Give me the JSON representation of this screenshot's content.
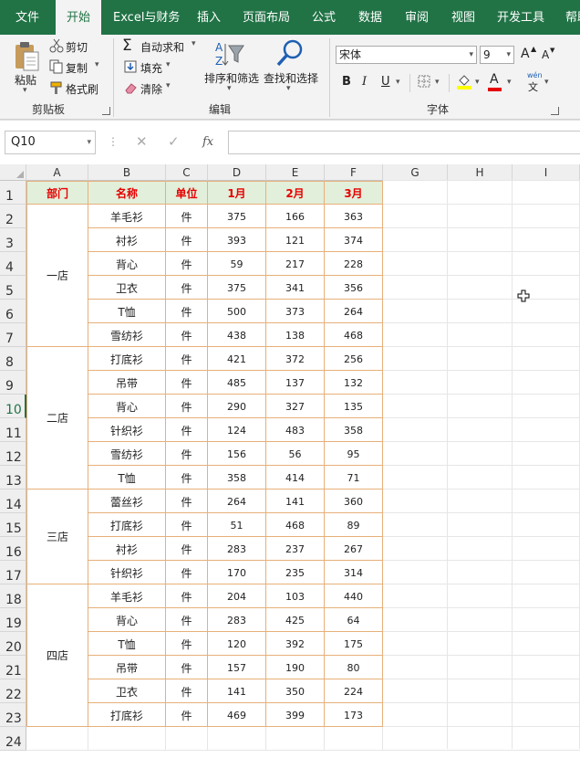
{
  "ribbon_tabs": [
    "文件",
    "开始",
    "Excel与财务",
    "插入",
    "页面布局",
    "公式",
    "数据",
    "审阅",
    "视图",
    "开发工具",
    "帮助"
  ],
  "clipboard": {
    "paste": "粘贴",
    "cut": "剪切",
    "copy": "复制",
    "format_painter": "格式刷",
    "group": "剪贴板"
  },
  "editing": {
    "autosum": "自动求和",
    "fill": "填充",
    "clear": "清除",
    "sort": "排序和筛选",
    "find": "查找和选择",
    "group": "编辑"
  },
  "font": {
    "name": "宋体",
    "size": "9",
    "group": "字体",
    "bold": "B",
    "italic": "I",
    "underline": "U",
    "grow": "A",
    "shrink": "A",
    "fontcolor": "A",
    "wen": "wén",
    "wen2": "文"
  },
  "name_box": "Q10",
  "fx_label": "fx",
  "cancel_glyph": "✕",
  "enter_glyph": "✓",
  "columns": [
    "A",
    "B",
    "C",
    "D",
    "E",
    "F",
    "G",
    "H",
    "I"
  ],
  "rows": [
    "1",
    "2",
    "3",
    "4",
    "5",
    "6",
    "7",
    "8",
    "9",
    "10",
    "11",
    "12",
    "13",
    "14",
    "15",
    "16",
    "17",
    "18",
    "19",
    "20",
    "21",
    "22",
    "23",
    "24"
  ],
  "selected_row": "10",
  "table": {
    "headers": [
      "部门",
      "名称",
      "单位",
      "1月",
      "2月",
      "3月"
    ],
    "groups": [
      {
        "dept": "一店",
        "items": [
          [
            "羊毛衫",
            "件",
            "375",
            "166",
            "363"
          ],
          [
            "衬衫",
            "件",
            "393",
            "121",
            "374"
          ],
          [
            "背心",
            "件",
            "59",
            "217",
            "228"
          ],
          [
            "卫衣",
            "件",
            "375",
            "341",
            "356"
          ],
          [
            "T恤",
            "件",
            "500",
            "373",
            "264"
          ],
          [
            "雪纺衫",
            "件",
            "438",
            "138",
            "468"
          ]
        ]
      },
      {
        "dept": "二店",
        "items": [
          [
            "打底衫",
            "件",
            "421",
            "372",
            "256"
          ],
          [
            "吊带",
            "件",
            "485",
            "137",
            "132"
          ],
          [
            "背心",
            "件",
            "290",
            "327",
            "135"
          ],
          [
            "针织衫",
            "件",
            "124",
            "483",
            "358"
          ],
          [
            "雪纺衫",
            "件",
            "156",
            "56",
            "95"
          ],
          [
            "T恤",
            "件",
            "358",
            "414",
            "71"
          ]
        ]
      },
      {
        "dept": "三店",
        "items": [
          [
            "蕾丝衫",
            "件",
            "264",
            "141",
            "360"
          ],
          [
            "打底衫",
            "件",
            "51",
            "468",
            "89"
          ],
          [
            "衬衫",
            "件",
            "283",
            "237",
            "267"
          ],
          [
            "针织衫",
            "件",
            "170",
            "235",
            "314"
          ]
        ]
      },
      {
        "dept": "四店",
        "items": [
          [
            "羊毛衫",
            "件",
            "204",
            "103",
            "440"
          ],
          [
            "背心",
            "件",
            "283",
            "425",
            "64"
          ],
          [
            "T恤",
            "件",
            "120",
            "392",
            "175"
          ],
          [
            "吊带",
            "件",
            "157",
            "190",
            "80"
          ],
          [
            "卫衣",
            "件",
            "141",
            "350",
            "224"
          ],
          [
            "打底衫",
            "件",
            "469",
            "399",
            "173"
          ]
        ]
      }
    ]
  },
  "colors": {
    "ribbon": "#217346",
    "header_fill": "#e2efda",
    "header_text": "#e60000",
    "border": "#e7b079"
  }
}
